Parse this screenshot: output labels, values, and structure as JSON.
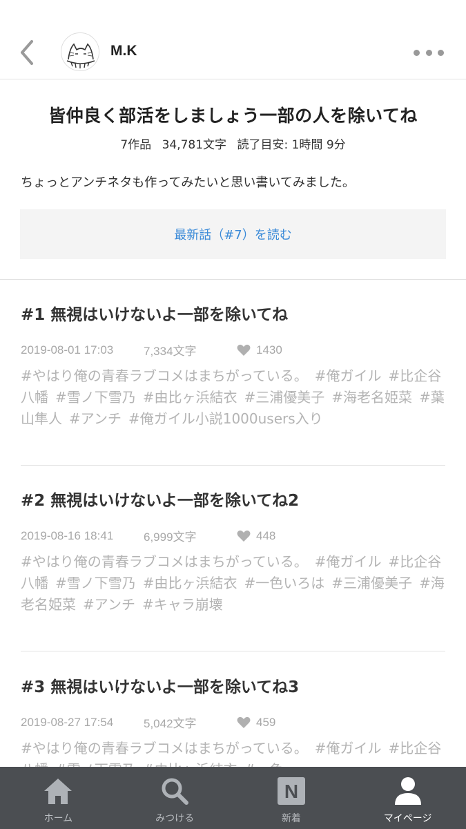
{
  "header": {
    "author": "M.K"
  },
  "series": {
    "title": "皆仲良く部活をしましょう一部の人を除いてね",
    "works": "7作品",
    "chars": "34,781文字",
    "read_time": "読了目安: 1時間 9分",
    "description": "ちょっとアンチネタも作ってみたいと思い書いてみました。",
    "latest_button": "最新話（#7）を読む"
  },
  "episodes": [
    {
      "title": "#1 無視はいけないよ一部を除いてね",
      "date": "2019-08-01 17:03",
      "chars": "7,334文字",
      "likes": "1430",
      "tags": [
        "#やはり俺の青春ラブコメはまちがっている。",
        "#俺ガイル",
        "#比企谷八幡",
        "#雪ノ下雪乃",
        "#由比ヶ浜結衣",
        "#三浦優美子",
        "#海老名姫菜",
        "#葉山隼人",
        "#アンチ",
        "#俺ガイル小説1000users入り"
      ]
    },
    {
      "title": "#2 無視はいけないよ一部を除いてね2",
      "date": "2019-08-16 18:41",
      "chars": "6,999文字",
      "likes": "448",
      "tags": [
        "#やはり俺の青春ラブコメはまちがっている。",
        "#俺ガイル",
        "#比企谷八幡",
        "#雪ノ下雪乃",
        "#由比ヶ浜結衣",
        "#一色いろは",
        "#三浦優美子",
        "#海老名姫菜",
        "#アンチ",
        "#キャラ崩壊"
      ]
    },
    {
      "title": "#3 無視はいけないよ一部を除いてね3",
      "date": "2019-08-27 17:54",
      "chars": "5,042文字",
      "likes": "459",
      "tags": [
        "#やはり俺の青春ラブコメはまちがっている。",
        "#俺ガイル",
        "#比企谷八幡",
        "#雪ノ下雪乃",
        "#由比ヶ浜結衣",
        "#一色"
      ]
    }
  ],
  "tabbar": {
    "home": "ホーム",
    "search": "みつける",
    "new": "新着",
    "mypage": "マイページ",
    "new_icon_letter": "N"
  },
  "colors": {
    "accent": "#3a8ad8",
    "tabbar_bg": "#4b4e52"
  }
}
